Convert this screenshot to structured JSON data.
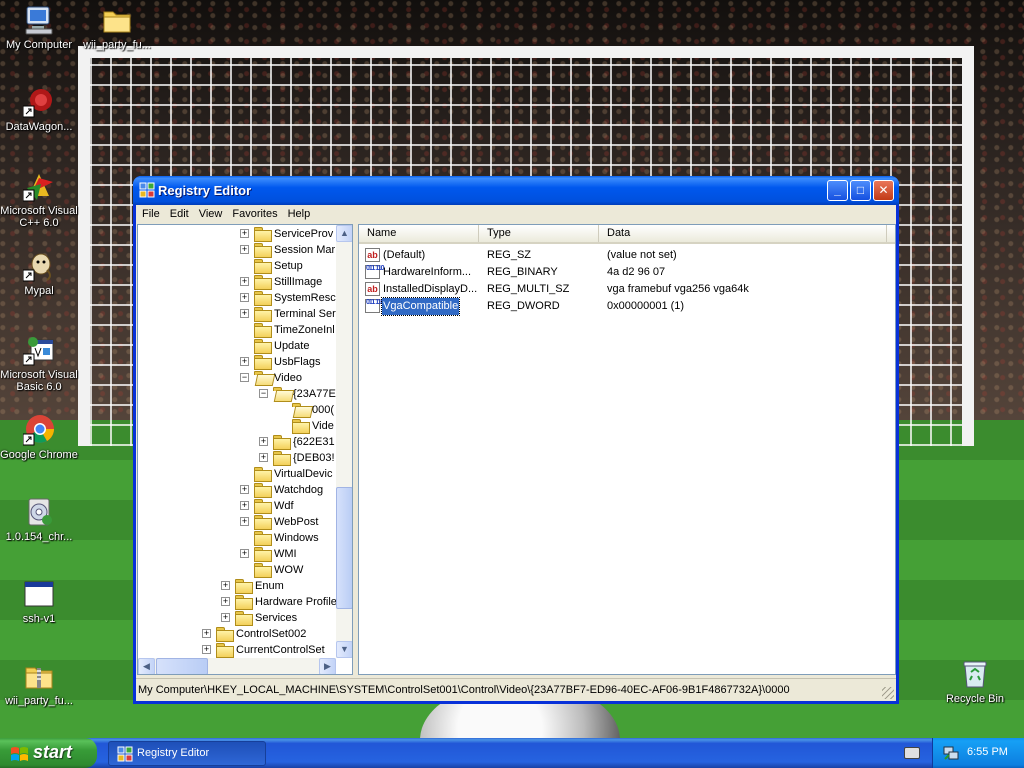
{
  "desktop": {
    "icons": [
      {
        "label": "My Computer",
        "icon": "my-computer-icon"
      },
      {
        "label": "wii_party_fu...",
        "icon": "folder-icon"
      },
      {
        "label": "DataWagon...",
        "icon": "datawagon-icon"
      },
      {
        "label": "Microsoft Visual C++ 6.0",
        "icon": "visual-cpp-icon"
      },
      {
        "label": "Mypal",
        "icon": "mypal-icon"
      },
      {
        "label": "Microsoft Visual Basic 6.0",
        "icon": "visual-basic-icon"
      },
      {
        "label": "Google Chrome",
        "icon": "chrome-icon"
      },
      {
        "label": "1.0.154_chr...",
        "icon": "installer-icon"
      },
      {
        "label": "ssh-v1",
        "icon": "window-app-icon"
      },
      {
        "label": "wii_party_fu...",
        "icon": "zip-folder-icon"
      },
      {
        "label": "Recycle Bin",
        "icon": "recycle-bin-icon"
      }
    ]
  },
  "window": {
    "title": "Registry Editor",
    "buttons": {
      "minimize": "_",
      "maximize": "□",
      "close": "✕"
    },
    "menu": [
      "File",
      "Edit",
      "View",
      "Favorites",
      "Help"
    ]
  },
  "tree": {
    "items": [
      {
        "label": "ServiceProv",
        "expander": "+"
      },
      {
        "label": "Session Mar",
        "expander": "+"
      },
      {
        "label": "Setup",
        "expander": ""
      },
      {
        "label": "StillImage",
        "expander": "+"
      },
      {
        "label": "SystemResc",
        "expander": "+"
      },
      {
        "label": "Terminal Ser",
        "expander": "+"
      },
      {
        "label": "TimeZoneInl",
        "expander": ""
      },
      {
        "label": "Update",
        "expander": ""
      },
      {
        "label": "UsbFlags",
        "expander": "+"
      },
      {
        "label": "Video",
        "expander": "−"
      },
      {
        "label": "{23A77E",
        "expander": "−"
      },
      {
        "label": "000(",
        "expander": ""
      },
      {
        "label": "Vide",
        "expander": ""
      },
      {
        "label": "{622E31",
        "expander": "+"
      },
      {
        "label": "{DEB03!",
        "expander": "+"
      },
      {
        "label": "VirtualDevic",
        "expander": ""
      },
      {
        "label": "Watchdog",
        "expander": "+"
      },
      {
        "label": "Wdf",
        "expander": "+"
      },
      {
        "label": "WebPost",
        "expander": "+"
      },
      {
        "label": "Windows",
        "expander": ""
      },
      {
        "label": "WMI",
        "expander": "+"
      },
      {
        "label": "WOW",
        "expander": ""
      },
      {
        "label": "Enum",
        "expander": "+"
      },
      {
        "label": "Hardware Profile",
        "expander": "+"
      },
      {
        "label": "Services",
        "expander": "+"
      },
      {
        "label": "ControlSet002",
        "expander": "+"
      },
      {
        "label": "CurrentControlSet",
        "expander": "+"
      }
    ]
  },
  "list": {
    "columns": [
      "Name",
      "Type",
      "Data"
    ],
    "rows": [
      {
        "name": "(Default)",
        "type": "REG_SZ",
        "data": "(value not set)",
        "icon": "string-value-icon",
        "icon_glyph": "ab"
      },
      {
        "name": "HardwareInform...",
        "type": "REG_BINARY",
        "data": "4a d2 96 07",
        "icon": "binary-value-icon",
        "icon_glyph": "011 110"
      },
      {
        "name": "InstalledDisplayD...",
        "type": "REG_MULTI_SZ",
        "data": "vga framebuf vga256 vga64k",
        "icon": "string-value-icon",
        "icon_glyph": "ab"
      },
      {
        "name": "VgaCompatible",
        "type": "REG_DWORD",
        "data": "0x00000001 (1)",
        "icon": "binary-value-icon",
        "icon_glyph": "011 110",
        "selected": true
      }
    ]
  },
  "statusbar": {
    "path": "My Computer\\HKEY_LOCAL_MACHINE\\SYSTEM\\ControlSet001\\Control\\Video\\{23A77BF7-ED96-40EC-AF06-9B1F4867732A}\\0000"
  },
  "taskbar": {
    "start_label": "start",
    "task_label": "Registry Editor",
    "clock": "6:55 PM"
  },
  "colors": {
    "title_blue": "#0058ee",
    "selection": "#316ac5",
    "start_green": "#389c38"
  }
}
